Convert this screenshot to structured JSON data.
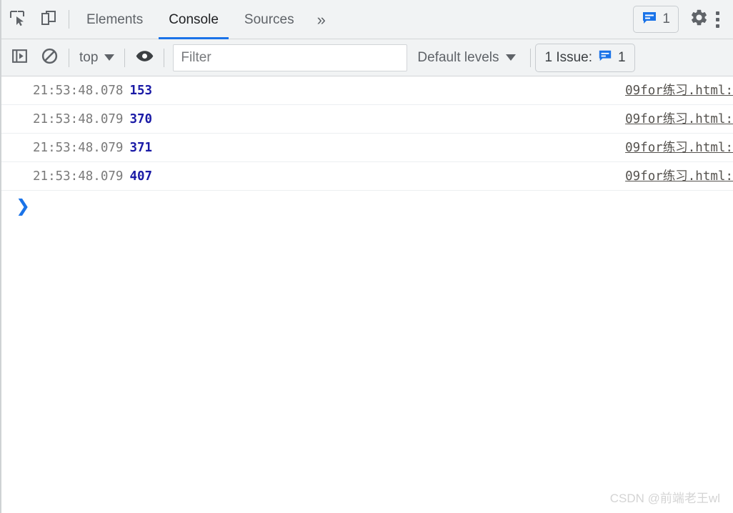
{
  "tabbar": {
    "inspect_icon": "inspect-element-icon",
    "device_icon": "device-toolbar-icon",
    "tabs": [
      {
        "label": "Elements",
        "selected": false
      },
      {
        "label": "Console",
        "selected": true
      },
      {
        "label": "Sources",
        "selected": false
      }
    ],
    "more_tabs_label": "»",
    "issues_count": "1",
    "issues_icon": "message-bubble-icon",
    "settings_icon": "gear-icon",
    "menu_icon": "kebab-menu-icon"
  },
  "filterbar": {
    "sidebar_icon": "console-sidebar-icon",
    "clear_icon": "clear-console-icon",
    "context_label": "top",
    "context_caret": "chevron-down-icon",
    "eye_icon": "live-expression-eye-icon",
    "filter_placeholder": "Filter",
    "filter_value": "",
    "levels_label": "Default levels",
    "levels_caret": "chevron-down-icon",
    "issue_badge_text": "1 Issue:",
    "issue_badge_icon": "message-bubble-icon",
    "issue_badge_count": "1"
  },
  "console": {
    "messages": [
      {
        "timestamp": "21:53:48.078",
        "value": "153",
        "source": "09for练习.html:"
      },
      {
        "timestamp": "21:53:48.079",
        "value": "370",
        "source": "09for练习.html:"
      },
      {
        "timestamp": "21:53:48.079",
        "value": "371",
        "source": "09for练习.html:"
      },
      {
        "timestamp": "21:53:48.079",
        "value": "407",
        "source": "09for练习.html:"
      }
    ],
    "prompt_caret": "❯",
    "prompt_value": ""
  },
  "watermark": {
    "text": "CSDN @前端老王wl"
  },
  "colors": {
    "accent": "#1a73e8",
    "toolbar_bg": "#f1f3f4",
    "value_blue": "#1a1aa6",
    "text_gray": "#5f6368"
  }
}
